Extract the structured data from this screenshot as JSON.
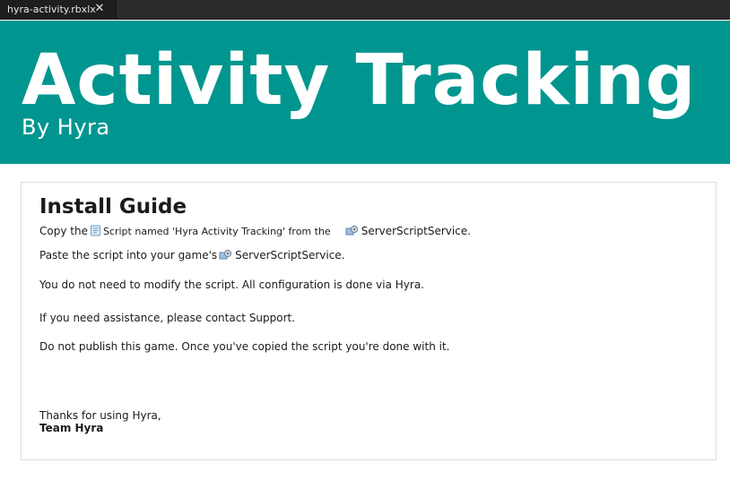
{
  "tab": {
    "filename": "hyra-activity.rbxlx",
    "close_glyph": "✕"
  },
  "banner": {
    "title": "Activity Tracking",
    "subtitle": "By Hyra",
    "background_color": "#00968f"
  },
  "guide": {
    "title": "Install Guide",
    "line1": {
      "prefix": "Copy the",
      "icon": "script-icon",
      "middle": "Script named 'Hyra Activity Tracking' from the",
      "service_icon": "server-script-service-icon",
      "service": "ServerScriptService."
    },
    "line2": {
      "prefix": "Paste the script into your game's",
      "service_icon": "server-script-service-icon",
      "service": "ServerScriptService."
    },
    "line3": "You do not need to modify the script. All configuration is done via Hyra.",
    "line4": "If you need assistance, please contact Support.",
    "line5": "Do not publish this game. Once you've copied the script you're done with it.",
    "thanks": "Thanks for using Hyra,",
    "signature": "Team Hyra"
  }
}
